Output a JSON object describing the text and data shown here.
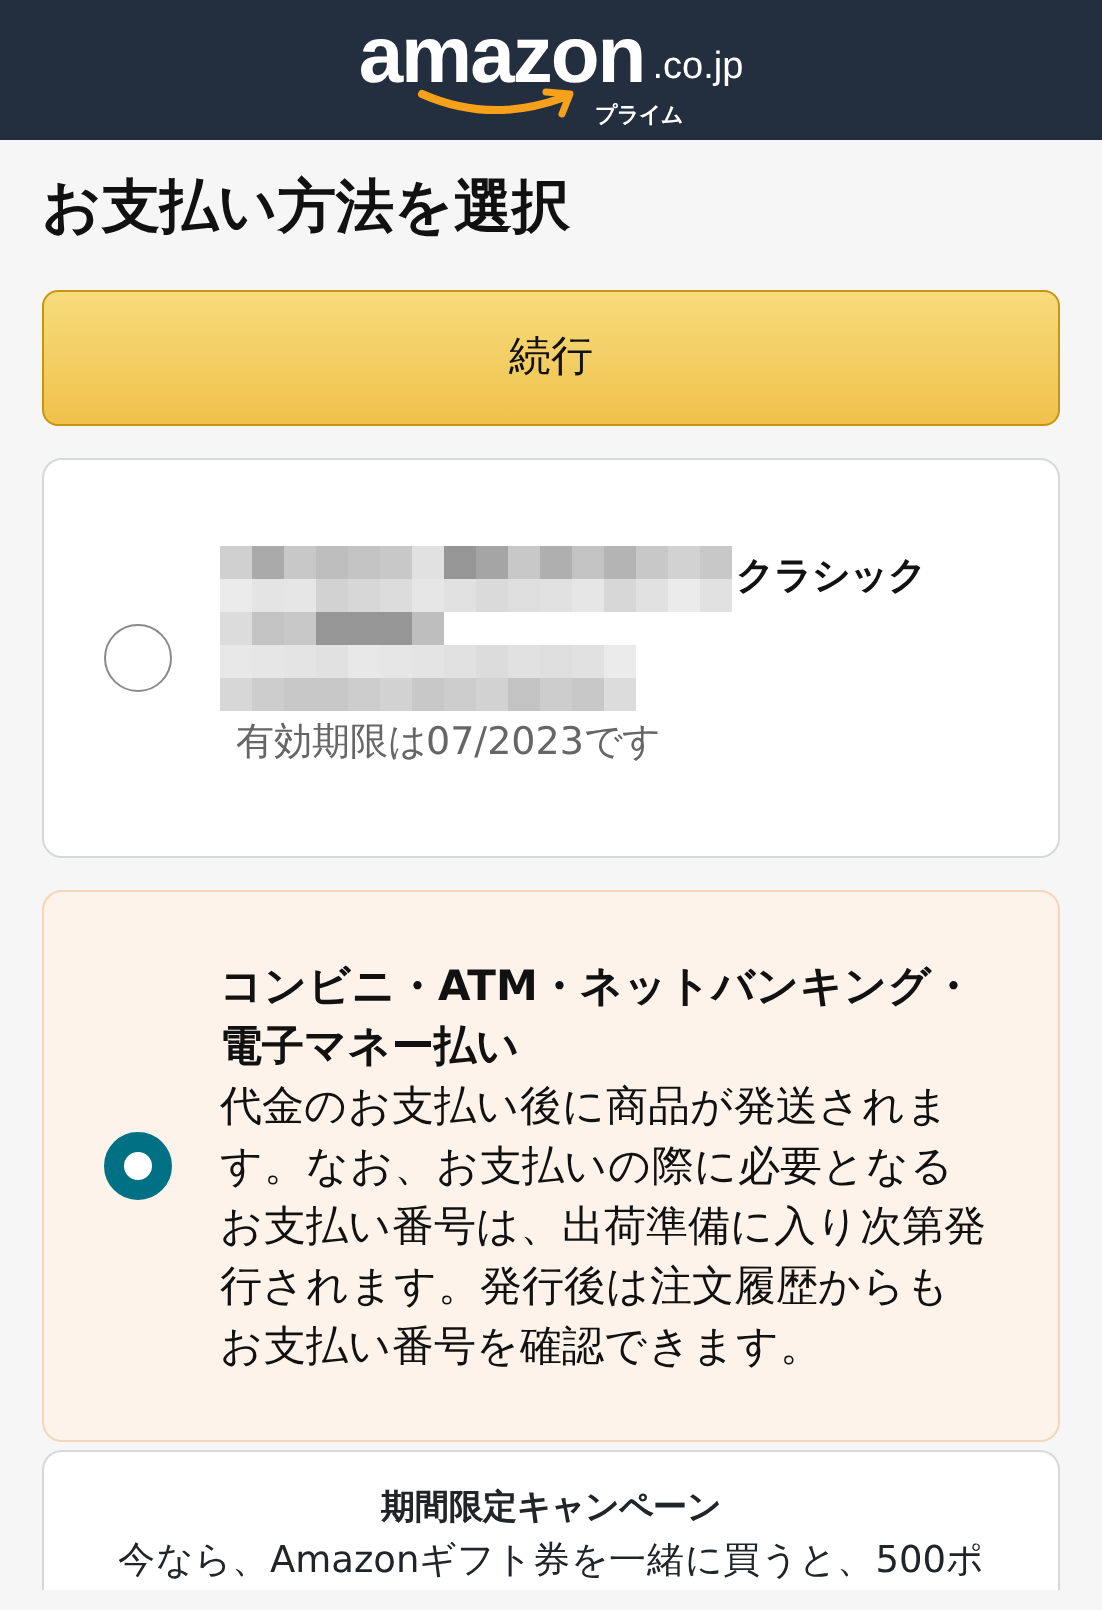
{
  "header": {
    "logo": "amazon",
    "logo_suffix": ".co.jp",
    "logo_tag": "プライム"
  },
  "title": "お支払い方法を選択",
  "continue_button": "続行",
  "options": [
    {
      "kind": "card",
      "selected": false,
      "redacted": true,
      "name_suffix": "クラシック",
      "detail": "有効期限は07/2023です"
    },
    {
      "kind": "convenience",
      "selected": true,
      "name": "コンビニ・ATM・ネットバンキング・電子マネー払い",
      "description": "代金のお支払い後に商品が発送されます。なお、お支払いの際に必要となるお支払い番号は、出荷準備に入り次第発行されます。発行後は注文履歴からもお支払い番号を確認できます。"
    }
  ],
  "campaign": {
    "title": "期間限定キャンペーン",
    "text": "今なら、Amazonギフト券を一緒に買うと、500ポ"
  }
}
